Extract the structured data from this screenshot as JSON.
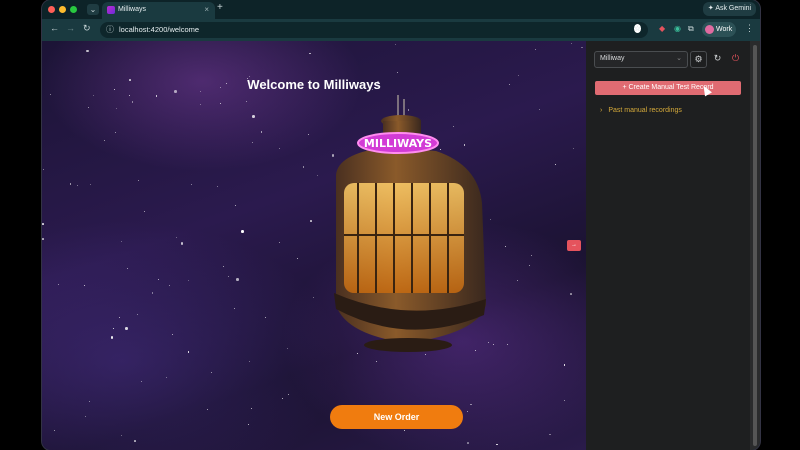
{
  "browser": {
    "tab_title": "Milliways",
    "tab_close": "×",
    "new_tab": "+",
    "ask_gemini": "Ask Gemini",
    "url": "localhost:4200/welcome",
    "profile": "Work"
  },
  "page": {
    "heading": "Welcome to Milliways",
    "sign_text": "MILLIWAYS",
    "primary_button": "New Order",
    "side_toggle": "→"
  },
  "panel": {
    "project_select": "Milliway",
    "create_button": "+ Create Manual Test Record",
    "past_recordings": "Past manual recordings"
  },
  "colors": {
    "accent_orange": "#f07c0f",
    "create_pink": "#e06b72",
    "past_gold": "#d4a93a",
    "sign_magenta": "#d23bd6"
  }
}
